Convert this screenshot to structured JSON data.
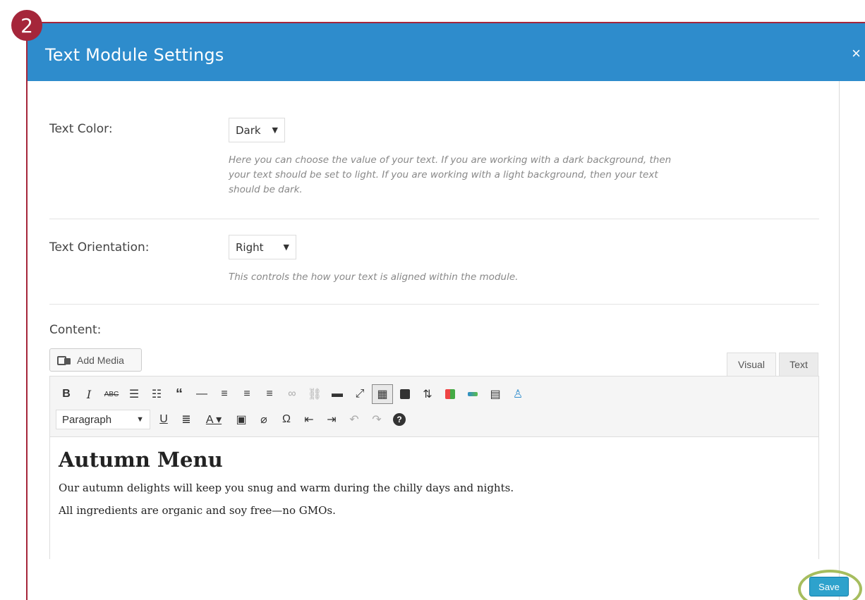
{
  "step_badge": "2",
  "modal": {
    "title": "Text Module Settings",
    "close_label": "×"
  },
  "fields": {
    "text_color": {
      "label": "Text Color:",
      "value": "Dark",
      "help": "Here you can choose the value of your text. If you are working with a dark background, then your text should be set to light. If you are working with a light background, then your text should be dark."
    },
    "text_orientation": {
      "label": "Text Orientation:",
      "value": "Right",
      "help": "This controls the how your text is aligned within the module."
    },
    "content": {
      "label": "Content:"
    }
  },
  "editor": {
    "add_media_label": "Add Media",
    "tabs": {
      "visual": "Visual",
      "text": "Text"
    },
    "format_select": "Paragraph",
    "toolbar_row1": [
      {
        "name": "bold-icon",
        "glyph": "B"
      },
      {
        "name": "italic-icon",
        "glyph": "I"
      },
      {
        "name": "strikethrough-icon",
        "glyph": "abc"
      },
      {
        "name": "bullet-list-icon",
        "glyph": "☰"
      },
      {
        "name": "numbered-list-icon",
        "glyph": "☷"
      },
      {
        "name": "blockquote-icon",
        "glyph": "❝"
      },
      {
        "name": "horizontal-rule-icon",
        "glyph": "—"
      },
      {
        "name": "align-left-icon",
        "glyph": "≡"
      },
      {
        "name": "align-center-icon",
        "glyph": "≡"
      },
      {
        "name": "align-right-icon",
        "glyph": "≡"
      },
      {
        "name": "link-icon",
        "glyph": "🔗"
      },
      {
        "name": "unlink-icon",
        "glyph": "⛓"
      },
      {
        "name": "read-more-icon",
        "glyph": "▬"
      },
      {
        "name": "fullscreen-icon",
        "glyph": "⤢"
      },
      {
        "name": "toolbar-toggle-icon",
        "glyph": "⌨"
      }
    ],
    "toolbar_row2": [
      {
        "name": "underline-icon",
        "glyph": "U"
      },
      {
        "name": "justify-icon",
        "glyph": "≣"
      },
      {
        "name": "text-color-icon",
        "glyph": "A"
      },
      {
        "name": "paste-as-text-icon",
        "glyph": "📋"
      },
      {
        "name": "clear-formatting-icon",
        "glyph": "⌀"
      },
      {
        "name": "special-character-icon",
        "glyph": "Ω"
      },
      {
        "name": "outdent-icon",
        "glyph": "⇤"
      },
      {
        "name": "indent-icon",
        "glyph": "⇥"
      },
      {
        "name": "undo-icon",
        "glyph": "↶"
      },
      {
        "name": "redo-icon",
        "glyph": "↷"
      },
      {
        "name": "help-icon",
        "glyph": "?"
      }
    ],
    "content": {
      "heading": "Autumn Menu",
      "paragraph_1": "Our autumn delights will keep you snug and warm during the chilly days and nights.",
      "paragraph_2": "All ingredients are organic and soy free—no GMOs."
    }
  },
  "footer": {
    "save_label": "Save"
  },
  "colors": {
    "header_bg": "#2e8ccc",
    "frame_border": "#a5263a",
    "save_bg": "#2ea2cc",
    "highlight_ring": "#a6bd5e"
  }
}
